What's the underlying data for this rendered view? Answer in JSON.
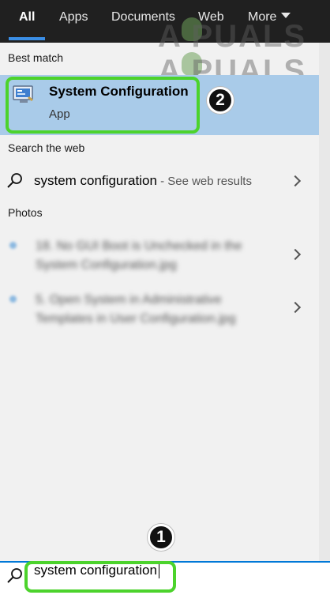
{
  "tabs": [
    {
      "label": "All",
      "active": true
    },
    {
      "label": "Apps"
    },
    {
      "label": "Documents"
    },
    {
      "label": "Web"
    },
    {
      "label": "More"
    }
  ],
  "watermark": {
    "line1": "A  PUALS",
    "line2": "A  PUALS"
  },
  "best_match": {
    "heading": "Best match",
    "title": "System Configuration",
    "subtitle": "App",
    "icon": "msconfig-icon"
  },
  "web": {
    "heading": "Search the web",
    "query": "system configuration",
    "suffix": " - See web results"
  },
  "photos": {
    "heading": "Photos",
    "items": [
      {
        "line1": "18. No GUI Boot is Unchecked in the",
        "line2": "System Configuration.jpg"
      },
      {
        "line1": "5. Open System in Administrative",
        "line2": "Templates in User Configuration.jpg"
      }
    ]
  },
  "search": {
    "value": "system configuration"
  },
  "steps": {
    "one": "1",
    "two": "2"
  },
  "colors": {
    "accent": "#0078d7",
    "highlight": "#4cd32c",
    "selected": "#a9cbe9"
  }
}
